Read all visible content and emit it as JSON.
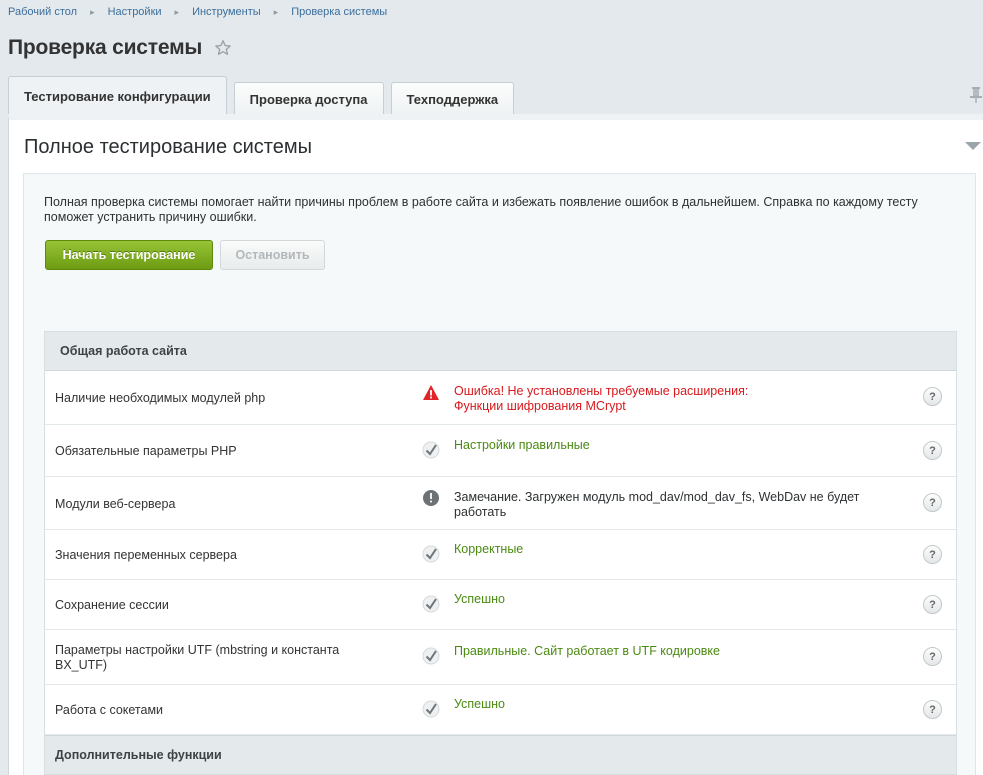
{
  "breadcrumb": [
    "Рабочий стол",
    "Настройки",
    "Инструменты",
    "Проверка системы"
  ],
  "page": {
    "title": "Проверка системы"
  },
  "tabs": [
    {
      "label": "Тестирование конфигурации",
      "active": true
    },
    {
      "label": "Проверка доступа",
      "active": false
    },
    {
      "label": "Техподдержка",
      "active": false
    }
  ],
  "panel": {
    "title": "Полное тестирование системы",
    "description": "Полная проверка системы помогает найти причины проблем в работе сайта и избежать появление ошибок в дальнейшем. Справка по каждому тесту поможет устранить причину ошибки.",
    "start_button": "Начать тестирование",
    "stop_button": "Остановить"
  },
  "results": {
    "section1": "Общая работа сайта",
    "section2": "Дополнительные функции",
    "rows": [
      {
        "label": "Наличие необходимых модулей php",
        "status": "error",
        "text": "Ошибка! Не установлены требуемые расширения: Функции шифрования MCrypt"
      },
      {
        "label": "Обязательные параметры PHP",
        "status": "ok",
        "text": "Настройки правильные"
      },
      {
        "label": "Модули веб-сервера",
        "status": "warning",
        "text": "Замечание. Загружен модуль mod_dav/mod_dav_fs, WebDav не будет работать"
      },
      {
        "label": "Значения переменных сервера",
        "status": "ok",
        "text": "Корректные"
      },
      {
        "label": "Сохранение сессии",
        "status": "ok",
        "text": "Успешно"
      },
      {
        "label": "Параметры настройки UTF (mbstring и константа BX_UTF)",
        "status": "ok",
        "text": "Правильные. Сайт работает в UTF кодировке"
      },
      {
        "label": "Работа с сокетами",
        "status": "ok",
        "text": "Успешно"
      }
    ],
    "help_symbol": "?"
  },
  "colors": {
    "error": "#d9191c",
    "ok": "#4b8a12",
    "start_button": "#7cab1c"
  },
  "icons": {
    "favorite": "star-icon",
    "pin": "pin-icon",
    "error": "warning-triangle-icon",
    "ok": "checkmark-icon",
    "warning": "exclamation-circle-icon",
    "help": "question-icon",
    "collapse": "triangle-down-icon"
  }
}
